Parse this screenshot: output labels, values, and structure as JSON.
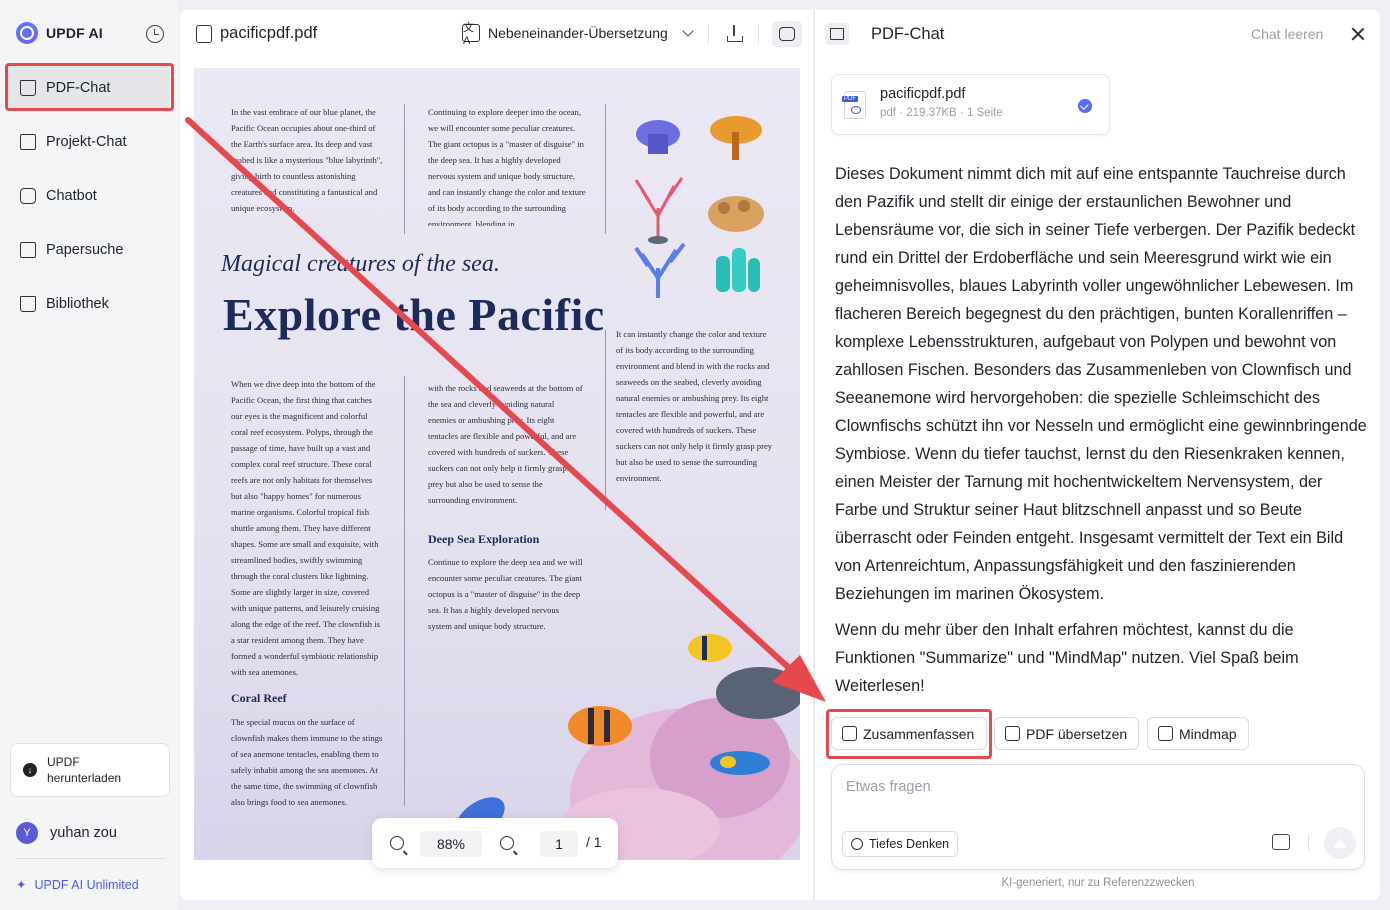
{
  "app": {
    "brand": "UPDF AI",
    "icons": {
      "logo": "updf-logo-icon",
      "history": "history-icon"
    }
  },
  "sidebar": {
    "items": [
      {
        "label": "PDF-Chat",
        "icon": "book-open-icon",
        "active": true
      },
      {
        "label": "Projekt-Chat",
        "icon": "folder-plus-icon",
        "active": false
      },
      {
        "label": "Chatbot",
        "icon": "chat-bot-icon",
        "active": false
      },
      {
        "label": "Papersuche",
        "icon": "search-doc-icon",
        "active": false
      },
      {
        "label": "Bibliothek",
        "icon": "library-icon",
        "active": false
      }
    ],
    "download": {
      "line1": "UPDF",
      "line2": "herunterladen"
    },
    "user": {
      "initial": "Y",
      "name": "yuhan zou"
    },
    "unlimited": "UPDF AI Unlimited"
  },
  "viewer": {
    "file_name": "pacificpdf.pdf",
    "translate_mode": "Nebeneinander-Übersetzung",
    "zoom": "88%",
    "page_current": "1",
    "page_total": "/ 1",
    "document": {
      "col1_top": "In the vast embrace of our blue planet, the Pacific Ocean occupies about one-third of the Earth's surface area. Its deep and vast seabed is like a mysterious \"blue labyrinth\", giving birth to countless astonishing creatures and constituting a fantastical and unique ecosystem.",
      "col2_top": "Continuing to explore deeper into the ocean, we will encounter some peculiar creatures. The giant octopus is a \"master of disguise\" in the deep sea. It has a highly developed nervous system and unique body structure, and can instantly change the color and texture of its body according to the surrounding environment, blending in",
      "subtitle": "Magical creatures of the sea.",
      "title": "Explore the Pacific",
      "col3_mid": "It can instantly change the color and texture of its body according to the surrounding environment and blend in with the rocks and seaweeds on the seabed, cleverly avoiding natural enemies or ambushing prey. Its eight tentacles are flexible and powerful, and are covered with hundreds of suckers. These suckers can not only help it firmly grasp prey but also be used to sense the surrounding environment.",
      "col1_main": "When we dive deep into the bottom of the Pacific Ocean, the first thing that catches our eyes is the magnificent and colorful coral reef ecosystem. Polyps, through the passage of time, have built up a vast and complex coral reef structure. These coral reefs are not only habitats for themselves but also \"happy homes\" for numerous marine organisms. Colorful tropical fish shuttle among them. They have different shapes. Some are small and exquisite, with streamlined bodies, swiftly swimming through the coral clusters like lightning. Some are slightly larger in size, covered with unique patterns, and leisurely cruising along the edge of the reef. The clownfish is a star resident among them. They have formed a wonderful symbiotic relationship with sea anemones.",
      "col2_main": "with the rocks and seaweeds at the bottom of the sea and cleverly avoiding natural enemies or ambushing prey. Its eight tentacles are flexible and powerful, and are covered with hundreds of suckers. These suckers can not only help it firmly grasp prey but also be used to sense the surrounding environment.",
      "heading_deep": "Deep Sea Exploration",
      "col2_deep": "Continue to explore the deep sea and we will encounter some peculiar creatures. The giant octopus is a \"master of disguise\" in the deep sea. It has a highly developed nervous system and unique body structure.",
      "heading_coral": "Coral Reef",
      "col1_coral": "The special mucus on the surface of clownfish makes them immune to the stings of sea anemone tentacles, enabling them to safely inhabit among the sea anemones. At the same time, the swimming of clownfish also brings food to sea anemones."
    }
  },
  "chat": {
    "title": "PDF-Chat",
    "clear": "Chat leeren",
    "file_card": {
      "name": "pacificpdf.pdf",
      "meta": "pdf · 219.37KB · 1 Seite"
    },
    "answer_p1": "Dieses Dokument nimmt dich mit auf eine entspannte Tauchreise durch den Pazifik und stellt dir einige der erstaunlichen Bewohner und Lebensräume vor, die sich in seiner Tiefe verbergen. Der Pazifik bedeckt rund ein Drittel der Erdoberfläche und sein Meeresgrund wirkt wie ein geheimnisvolles, blaues Labyrinth voller ungewöhnlicher Lebewesen. Im flacheren Bereich begegnest du den prächtigen, bunten Korallenriffen – komplexe Lebensstrukturen, aufgebaut von Polypen und bewohnt von zahllosen Fischen. Besonders das Zusammenleben von Clownfisch und Seeanemone wird hervorgehoben: die spezielle Schleimschicht des Clownfischs schützt ihn vor Nesseln und ermöglicht eine gewinnbringende Symbiose. Wenn du tiefer tauchst, lernst du den Riesenkraken kennen, einen Meister der Tarnung mit hochentwickeltem Nervensystem, der Farbe und Struktur seiner Haut blitzschnell anpasst und so Beute überrascht oder Feinden entgeht. Insgesamt vermittelt der Text ein Bild von Artenreichtum, Anpassungsfähigkeit und den faszinierenden Beziehungen im marinen Ökosystem.",
    "answer_p2": "Wenn du mehr über den Inhalt erfahren möchtest, kannst du die Funktionen \"Summarize\" und \"MindMap\" nutzen. Viel Spaß beim Weiterlesen!",
    "actions": {
      "summarize": "Zusammenfassen",
      "translate": "PDF übersetzen",
      "mindmap": "Mindmap"
    },
    "input_placeholder": "Etwas fragen",
    "deep_think": "Tiefes Denken",
    "disclaimer": "KI-generiert, nur zu Referenzzwecken"
  },
  "colors": {
    "accent": "#4a5cf0",
    "highlight": "#e5484d",
    "title": "#1d2a5c"
  }
}
